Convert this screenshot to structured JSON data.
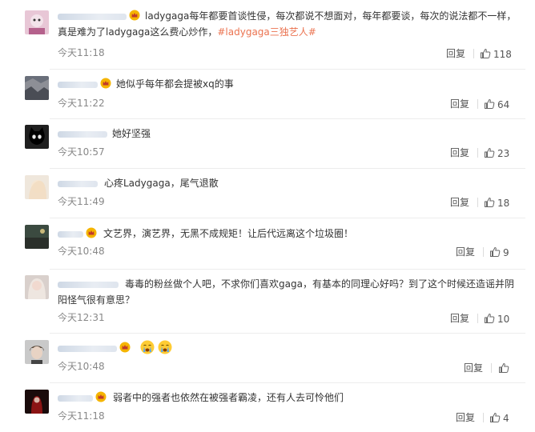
{
  "comments": [
    {
      "text": "ladygaga每年都要首谈性侵，每次都说不想面对，每年都要谈，每次的说法都不一样，真是难为了ladygaga这么费心炒作，",
      "tag": "#ladygaga三独艺人#",
      "time": "今天11:18",
      "reply": "回复",
      "likes": "118"
    },
    {
      "text": "她似乎每年都会提被xq的事",
      "time": "今天11:22",
      "reply": "回复",
      "likes": "64"
    },
    {
      "text": "她好坚强",
      "time": "今天10:57",
      "reply": "回复",
      "likes": "23"
    },
    {
      "text": "心疼Ladygaga，尾气退散",
      "time": "今天11:49",
      "reply": "回复",
      "likes": "18"
    },
    {
      "text": "文艺界，演艺界，无黑不成规矩！让后代远离这个垃圾圈！",
      "time": "今天10:48",
      "reply": "回复",
      "likes": "9"
    },
    {
      "text": "毒毒的粉丝做个人吧，不求你们喜欢gaga，有基本的同理心好吗？到了这个时候还造谣并阴阳怪气很有意思？",
      "time": "今天12:31",
      "reply": "回复",
      "likes": "10"
    },
    {
      "text": "",
      "time": "今天10:48",
      "reply": "回复",
      "likes": "",
      "emojis": [
        "crying-face-emoji",
        "crying-face-emoji"
      ]
    },
    {
      "text": "弱者中的强者也依然在被强者霸凌，还有人去可怜他们",
      "time": "今天11:18",
      "reply": "回复",
      "likes": "4"
    }
  ],
  "colors": {
    "text": "#333333",
    "time": "#888888",
    "tag": "#eb7350",
    "divider": "#ececec"
  }
}
